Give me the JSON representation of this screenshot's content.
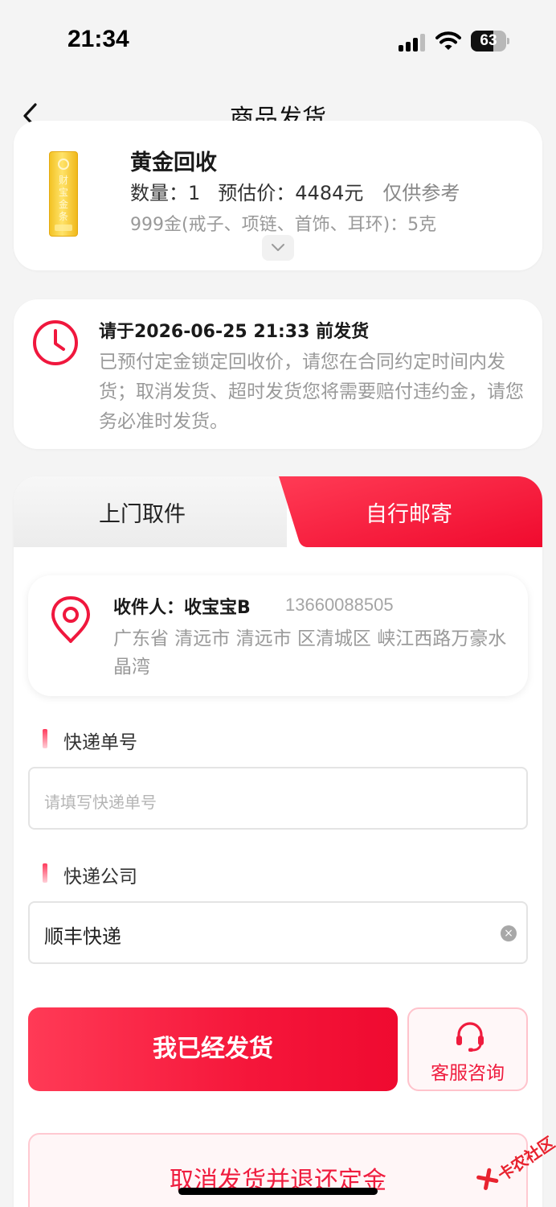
{
  "status_bar": {
    "time": "21:34",
    "battery": "63",
    "battery_level_percent": 63
  },
  "nav": {
    "title": "商品发货"
  },
  "product": {
    "name": "黄金回收",
    "quantity_label": "数量：",
    "quantity": "1",
    "price_label": "预估价：",
    "price": "4484元",
    "price_note": "仅供参考",
    "spec": "999金(戒子、项链、首饰、耳环)：5克",
    "bar_chars": "财宝金条"
  },
  "deadline": {
    "title": "请于2026-06-25 21:33 前发货",
    "description": "已预付定金锁定回收价，请您在合同约定时间内发货；取消发货、超时发货您将需要赔付违约金，请您务必准时发货。"
  },
  "tabs": {
    "pickup": "上门取件",
    "self_mail": "自行邮寄",
    "active": "self_mail"
  },
  "recipient": {
    "label": "收件人：收宝宝B",
    "phone": "13660088505",
    "address": "广东省 清远市 清远市 区清城区 峡江西路万豪水晶湾"
  },
  "form": {
    "tracking_label": "快递单号",
    "tracking_placeholder": "请填写快递单号",
    "company_label": "快递公司",
    "company_value": "顺丰快递"
  },
  "actions": {
    "shipped": "我已经发货",
    "customer_service": "客服咨询",
    "cancel": "取消发货并退还定金"
  },
  "watermark": {
    "text": "卡农社区"
  },
  "colors": {
    "accent": "#f5163a",
    "accent_light": "#ff3a56",
    "muted": "#9a9a9a"
  }
}
